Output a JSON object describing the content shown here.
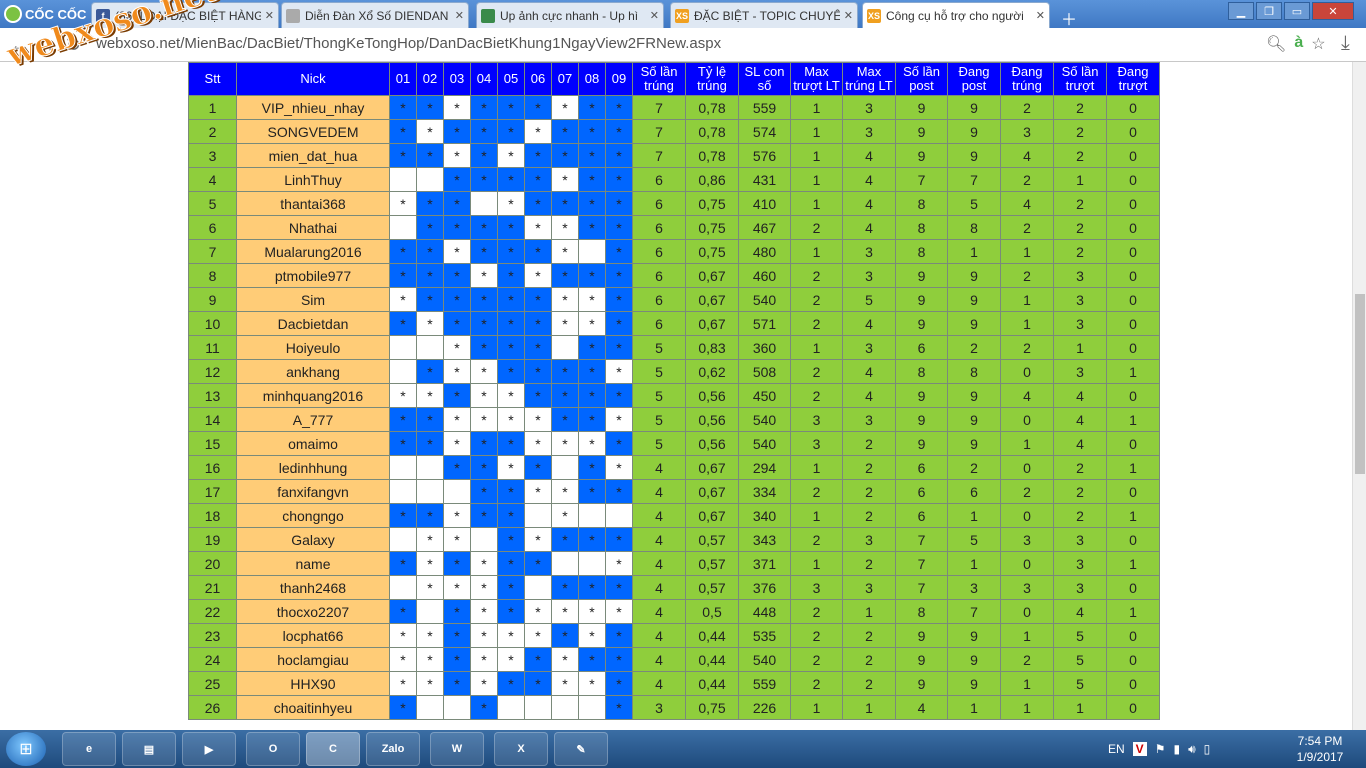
{
  "browser": {
    "brand": "CỐC CỐC",
    "tabs": [
      {
        "title": "(36) LOẠI ĐẶC BIỆT HÀNG",
        "icon": "facebook-icon",
        "icon_text": "f",
        "icon_color": "#3b5998",
        "active": false
      },
      {
        "title": "Diễn Đàn Xổ Số DIENDAN",
        "icon": "page-icon",
        "icon_text": "",
        "icon_color": "#aaaaaa",
        "active": false
      },
      {
        "title": "Up ảnh cực nhanh - Up hì",
        "icon": "image-upload-icon",
        "icon_text": "",
        "icon_color": "#3a8a4a",
        "active": false
      },
      {
        "title": "ĐẶC BIỆT - TOPIC CHUYÊN",
        "icon": "xs-icon",
        "icon_text": "XS",
        "icon_color": "#f0a020",
        "active": false
      },
      {
        "title": "Công cụ hỗ trợ cho người",
        "icon": "xs-icon",
        "icon_text": "XS",
        "icon_color": "#f0a020",
        "active": true
      }
    ],
    "url": "webxoso.net/MienBac/DacBiet/ThongKeTongHop/DanDacBietKhung1NgayView2FRNew.aspx",
    "url_text": "webxoso.net/MienBac/DacBiet/ThongKeTongHop/DanDacBietKhung1NgayView2FRNew.aspx"
  },
  "watermark": "webxoso.net",
  "table": {
    "headers": [
      "Stt",
      "Nick",
      "01",
      "02",
      "03",
      "04",
      "05",
      "06",
      "07",
      "08",
      "09",
      "Số lần trúng",
      "Tỷ lệ trúng",
      "SL con số",
      "Max trượt LT",
      "Max trúng LT",
      "Số lần post",
      "Đang post",
      "Đang trúng",
      "Số lần trượt",
      "Đang trượt"
    ],
    "rows": [
      {
        "stt": "1",
        "nick": "VIP_nhieu_nhay",
        "marks": "BBWBBBWBB",
        "stats": [
          "7",
          "0,78",
          "559",
          "1",
          "3",
          "9",
          "9",
          "2",
          "2",
          "0"
        ]
      },
      {
        "stt": "2",
        "nick": "SONGVEDEM",
        "marks": "BWBBBWBBB",
        "stats": [
          "7",
          "0,78",
          "574",
          "1",
          "3",
          "9",
          "9",
          "3",
          "2",
          "0"
        ]
      },
      {
        "stt": "3",
        "nick": "mien_dat_hua",
        "marks": "BBWBWBBBB",
        "stats": [
          "7",
          "0,78",
          "576",
          "1",
          "4",
          "9",
          "9",
          "4",
          "2",
          "0"
        ]
      },
      {
        "stt": "4",
        "nick": "LinhThuy",
        "marks": "EEBBBBWBB",
        "stats": [
          "6",
          "0,86",
          "431",
          "1",
          "4",
          "7",
          "7",
          "2",
          "1",
          "0"
        ]
      },
      {
        "stt": "5",
        "nick": "thantai368",
        "marks": "WBBEWBBBB",
        "stats": [
          "6",
          "0,75",
          "410",
          "1",
          "4",
          "8",
          "5",
          "4",
          "2",
          "0"
        ]
      },
      {
        "stt": "6",
        "nick": "Nhathai",
        "marks": "EBBBBWWBB",
        "stats": [
          "6",
          "0,75",
          "467",
          "2",
          "4",
          "8",
          "8",
          "2",
          "2",
          "0"
        ]
      },
      {
        "stt": "7",
        "nick": "Mualarung2016",
        "marks": "BBWBBBWEB",
        "stats": [
          "6",
          "0,75",
          "480",
          "1",
          "3",
          "8",
          "1",
          "1",
          "2",
          "0"
        ]
      },
      {
        "stt": "8",
        "nick": "ptmobile977",
        "marks": "BBBWBWBBB",
        "stats": [
          "6",
          "0,67",
          "460",
          "2",
          "3",
          "9",
          "9",
          "2",
          "3",
          "0"
        ]
      },
      {
        "stt": "9",
        "nick": "Sim",
        "marks": "WBBBBBWWB",
        "stats": [
          "6",
          "0,67",
          "540",
          "2",
          "5",
          "9",
          "9",
          "1",
          "3",
          "0"
        ]
      },
      {
        "stt": "10",
        "nick": "Dacbietdan",
        "marks": "BWBBBBWWB",
        "stats": [
          "6",
          "0,67",
          "571",
          "2",
          "4",
          "9",
          "9",
          "1",
          "3",
          "0"
        ]
      },
      {
        "stt": "11",
        "nick": "Hoiyeulo",
        "marks": "EEWBBBEBB",
        "stats": [
          "5",
          "0,83",
          "360",
          "1",
          "3",
          "6",
          "2",
          "2",
          "1",
          "0"
        ]
      },
      {
        "stt": "12",
        "nick": "ankhang",
        "marks": "EBWWBBBBW",
        "stats": [
          "5",
          "0,62",
          "508",
          "2",
          "4",
          "8",
          "8",
          "0",
          "3",
          "1"
        ]
      },
      {
        "stt": "13",
        "nick": "minhquang2016",
        "marks": "WWBWWBBBB",
        "stats": [
          "5",
          "0,56",
          "450",
          "2",
          "4",
          "9",
          "9",
          "4",
          "4",
          "0"
        ]
      },
      {
        "stt": "14",
        "nick": "A_777",
        "marks": "BBWWWWBBW",
        "stats": [
          "5",
          "0,56",
          "540",
          "3",
          "3",
          "9",
          "9",
          "0",
          "4",
          "1"
        ]
      },
      {
        "stt": "15",
        "nick": "omaimo",
        "marks": "BBWBBWWWB",
        "stats": [
          "5",
          "0,56",
          "540",
          "3",
          "2",
          "9",
          "9",
          "1",
          "4",
          "0"
        ]
      },
      {
        "stt": "16",
        "nick": "ledinhhung",
        "marks": "EEBBWBEBW",
        "stats": [
          "4",
          "0,67",
          "294",
          "1",
          "2",
          "6",
          "2",
          "0",
          "2",
          "1"
        ]
      },
      {
        "stt": "17",
        "nick": "fanxifangvn",
        "marks": "EEEBBWWBB",
        "stats": [
          "4",
          "0,67",
          "334",
          "2",
          "2",
          "6",
          "6",
          "2",
          "2",
          "0"
        ]
      },
      {
        "stt": "18",
        "nick": "chongngo",
        "marks": "BBWBBEWEE",
        "stats": [
          "4",
          "0,67",
          "340",
          "1",
          "2",
          "6",
          "1",
          "0",
          "2",
          "1"
        ]
      },
      {
        "stt": "19",
        "nick": "Galaxy",
        "marks": "EWWEBWBBB",
        "stats": [
          "4",
          "0,57",
          "343",
          "2",
          "3",
          "7",
          "5",
          "3",
          "3",
          "0"
        ]
      },
      {
        "stt": "20",
        "nick": "name",
        "marks": "BWBWBBEEW",
        "stats": [
          "4",
          "0,57",
          "371",
          "1",
          "2",
          "7",
          "1",
          "0",
          "3",
          "1"
        ]
      },
      {
        "stt": "21",
        "nick": "thanh2468",
        "marks": "EWWWBEBBB",
        "stats": [
          "4",
          "0,57",
          "376",
          "3",
          "3",
          "7",
          "3",
          "3",
          "3",
          "0"
        ]
      },
      {
        "stt": "22",
        "nick": "thocxo2207",
        "marks": "BEBWBWWWW",
        "stats": [
          "4",
          "0,5",
          "448",
          "2",
          "1",
          "8",
          "7",
          "0",
          "4",
          "1"
        ]
      },
      {
        "stt": "23",
        "nick": "locphat66",
        "marks": "WWBWWWBWB",
        "stats": [
          "4",
          "0,44",
          "535",
          "2",
          "2",
          "9",
          "9",
          "1",
          "5",
          "0"
        ]
      },
      {
        "stt": "24",
        "nick": "hoclamgiau",
        "marks": "WWBWWBWBB",
        "stats": [
          "4",
          "0,44",
          "540",
          "2",
          "2",
          "9",
          "9",
          "2",
          "5",
          "0"
        ]
      },
      {
        "stt": "25",
        "nick": "HHX90",
        "marks": "WWBWBBWWB",
        "stats": [
          "4",
          "0,44",
          "559",
          "2",
          "2",
          "9",
          "9",
          "1",
          "5",
          "0"
        ]
      },
      {
        "stt": "26",
        "nick": "choaitinhyeu",
        "marks": "BEEBEEEEB",
        "stats": [
          "3",
          "0,75",
          "226",
          "1",
          "1",
          "4",
          "1",
          "1",
          "1",
          "0"
        ]
      }
    ]
  },
  "taskbar": {
    "apps": [
      {
        "name": "internet-explorer-app",
        "label": "e"
      },
      {
        "name": "file-explorer-app",
        "label": "▤"
      },
      {
        "name": "media-player-app",
        "label": "▶"
      },
      {
        "name": "opera-app",
        "label": "O"
      },
      {
        "name": "coccoc-app",
        "label": "C"
      },
      {
        "name": "zalo-app",
        "label": "Zalo"
      },
      {
        "name": "word-app",
        "label": "W"
      },
      {
        "name": "excel-app",
        "label": "X"
      },
      {
        "name": "paint-app",
        "label": "✎"
      }
    ],
    "lang": "EN",
    "time": "7:54 PM",
    "date": "1/9/2017"
  },
  "colors": {
    "header": "#0000ff",
    "stt": "#8fce3c",
    "nick": "#ffcc77",
    "mark_blue": "#0066ff",
    "mark_white": "#ffffff"
  }
}
